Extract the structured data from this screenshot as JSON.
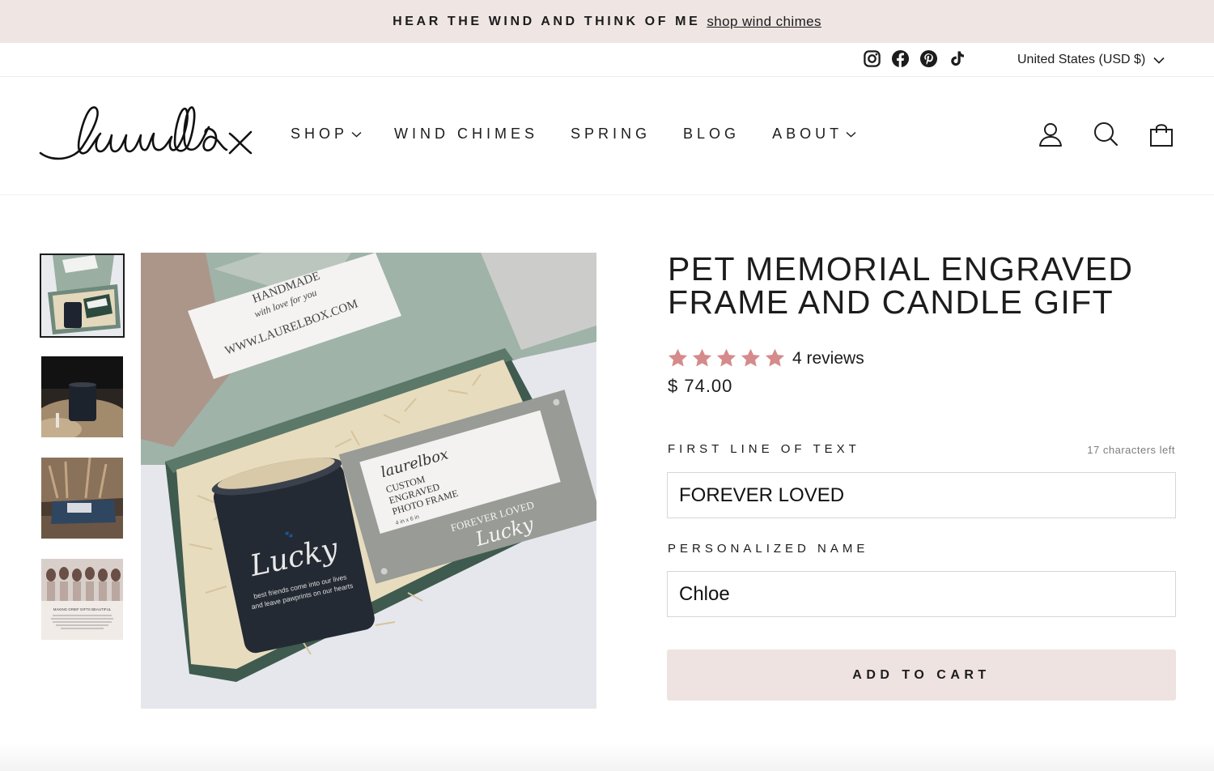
{
  "announcement": {
    "text": "HEAR THE WIND AND THINK OF ME",
    "link_label": "shop wind chimes"
  },
  "utility": {
    "social_icons": [
      "instagram-icon",
      "facebook-icon",
      "pinterest-icon",
      "tiktok-icon"
    ],
    "currency_label": "United States (USD $)"
  },
  "header": {
    "logo_text": "laurelbox",
    "nav": [
      {
        "label": "SHOP",
        "has_dropdown": true
      },
      {
        "label": "WIND CHIMES",
        "has_dropdown": false
      },
      {
        "label": "SPRING",
        "has_dropdown": false
      },
      {
        "label": "BLOG",
        "has_dropdown": false
      },
      {
        "label": "ABOUT",
        "has_dropdown": true
      }
    ],
    "icons": [
      "account-icon",
      "search-icon",
      "cart-icon"
    ]
  },
  "gallery": {
    "thumbnail_count": 4,
    "active_index": 0,
    "main_image": {
      "box_card_line1": "HANDMADE",
      "box_card_line2": "with love for you",
      "box_card_url": "WWW.LAURELBOX.COM",
      "frame_logo": "laurelbox",
      "frame_label_line1": "CUSTOM",
      "frame_label_line2": "ENGRAVED",
      "frame_label_line3": "PHOTO FRAME",
      "frame_size": "4 in x 6 in",
      "frame_engraving_line1": "FOREVER LOVED",
      "frame_engraving_line2": "Lucky",
      "candle_name": "Lucky",
      "candle_line1": "best friends come into our lives",
      "candle_line2": "and leave pawprints on our hearts"
    },
    "thumb4_caption": "MAKING GRIEF GIFTS BEAUTIFUL"
  },
  "product": {
    "title": "PET MEMORIAL ENGRAVED FRAME AND CANDLE GIFT",
    "rating": 5,
    "reviews_label": "4 reviews",
    "price": "$ 74.00",
    "star_color": "#d58b8b"
  },
  "form": {
    "first_line_label": "FIRST LINE OF TEXT",
    "chars_left": "17 characters left",
    "first_line_value": "FOREVER LOVED",
    "name_label": "PERSONALIZED NAME",
    "name_value": "Chloe",
    "add_to_cart_label": "ADD TO CART"
  },
  "colors": {
    "announcement_bg": "#efe6e4",
    "button_bg": "#eee3e1",
    "text": "#1c1c1c"
  }
}
